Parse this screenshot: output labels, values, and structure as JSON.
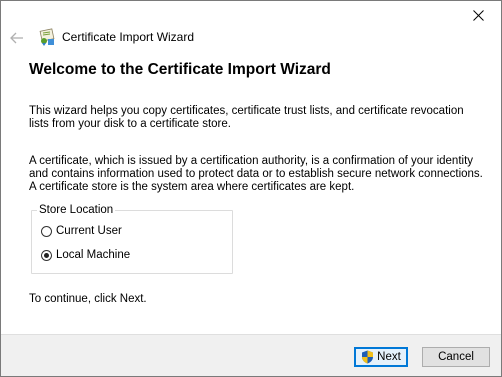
{
  "window": {
    "wizard_title": "Certificate Import Wizard"
  },
  "icons": {
    "back": "back-arrow-icon",
    "certificate": "certificate-icon",
    "close": "close-icon",
    "uac_shield": "uac-shield-icon"
  },
  "main": {
    "heading": "Welcome to the Certificate Import Wizard",
    "intro": "This wizard helps you copy certificates, certificate trust lists, and certificate revocation lists from your disk to a certificate store.",
    "description": "A certificate, which is issued by a certification authority, is a confirmation of your identity and contains information used to protect data or to establish secure network connections. A certificate store is the system area where certificates are kept.",
    "store_location": {
      "label": "Store Location",
      "options": [
        {
          "label": "Current User",
          "checked": false
        },
        {
          "label": "Local Machine",
          "checked": true
        }
      ]
    },
    "continue_text": "To continue, click Next."
  },
  "footer": {
    "next_label": "Next",
    "cancel_label": "Cancel"
  },
  "colors": {
    "accent": "#0078d7",
    "footer_bg": "#f0f0f0"
  }
}
